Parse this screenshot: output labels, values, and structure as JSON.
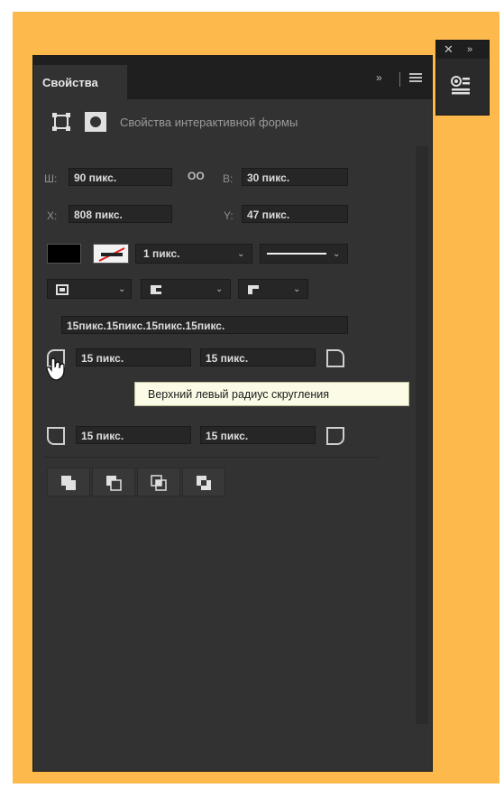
{
  "side_panel": {
    "close_icon": "close-icon",
    "collapse_label": "»",
    "props_icon": "properties-icon"
  },
  "panel": {
    "tab_label": "Свойства",
    "collapse_label": "»",
    "section_title": "Свойства интерактивной формы"
  },
  "size": {
    "w_label": "Ш:",
    "w_value": "90 пикс.",
    "h_label": "В:",
    "h_value": "30 пикс.",
    "link_icon": "link-icon"
  },
  "position": {
    "x_label": "X:",
    "x_value": "808 пикс.",
    "y_label": "Y:",
    "y_value": "47 пикс."
  },
  "appearance": {
    "fill_color": "#000000",
    "stroke_width": "1 пикс."
  },
  "corners": {
    "combined": "15пикс.15пикс.15пикс.15пикс.",
    "top_left": "15 пикс.",
    "top_right": "15 пикс.",
    "bottom_left": "15 пикс.",
    "bottom_right": "15 пикс."
  },
  "tooltip": "Верхний левый радиус скругления",
  "colors": {
    "background": "#fdb94b",
    "panel": "#323232",
    "field": "#262626"
  }
}
